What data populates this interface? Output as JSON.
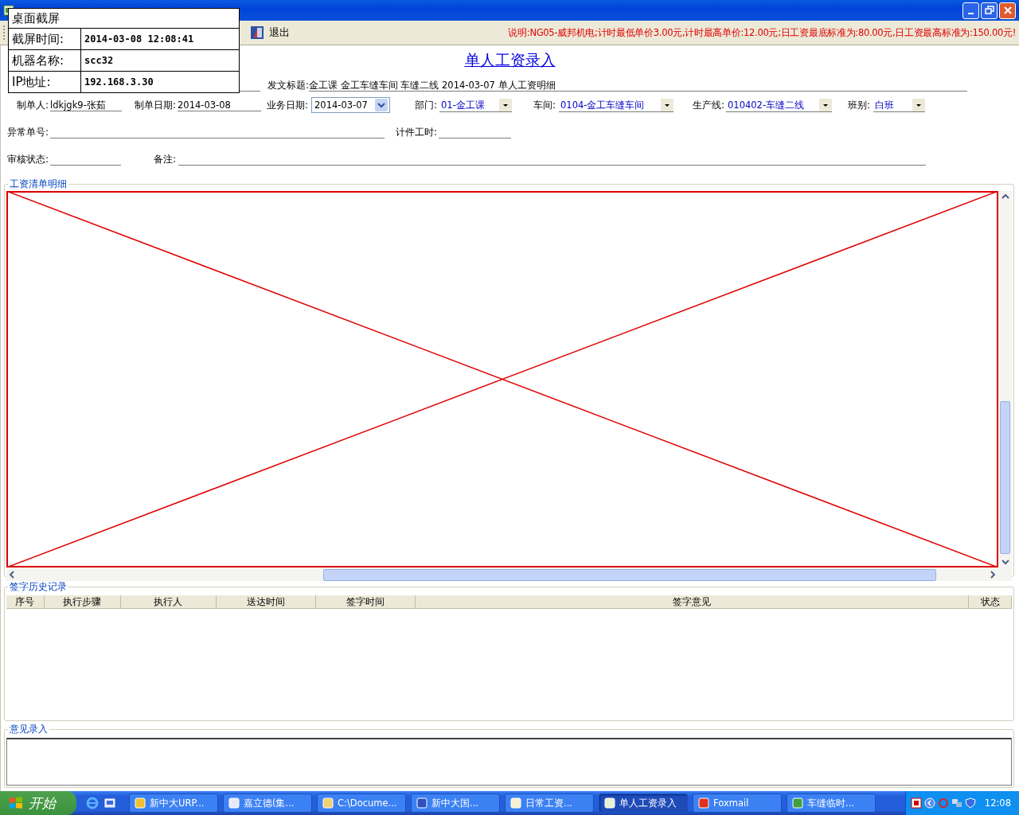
{
  "overlay": {
    "title": "桌面截屏",
    "rows": [
      {
        "label": "截屏时间:",
        "value": "2014-03-08 12:08:41"
      },
      {
        "label": "机器名称:",
        "value": "scc32"
      },
      {
        "label": "IP地址:",
        "value": "192.168.3.30"
      }
    ]
  },
  "toolbar": {
    "exit_button": "退出",
    "notice": "说明:NG05-威邦机电;计时最低单价3.00元,计时最高单价:12.00元;日工资最底标准为:80.00元,日工资最高标准为:150.00元!"
  },
  "form": {
    "heading": "单人工资录入",
    "subject_label": "发文标题:",
    "subject_value": "金工课 金工车缝车间 车缝二线 2014-03-07 单人工资明细",
    "rows": [
      [
        {
          "kind": "text",
          "label": "制单人:",
          "value": "ldkjgk9-张茹"
        },
        {
          "kind": "text",
          "label": "制单日期:",
          "value": "2014-03-08"
        },
        {
          "kind": "date",
          "label": "业务日期:",
          "value": "2014-03-07"
        },
        {
          "kind": "select",
          "label": "部门:",
          "value": "01-金工课"
        },
        {
          "kind": "select",
          "label": "车间:",
          "value": "0104-金工车缝车间"
        },
        {
          "kind": "select",
          "label": "生产线:",
          "value": "010402-车缝二线"
        },
        {
          "kind": "select",
          "label": "班别:",
          "value": "白班"
        }
      ],
      [
        {
          "kind": "text",
          "label": "异常单号:"
        },
        {
          "kind": "text",
          "label": "计件工时:"
        }
      ],
      [
        {
          "kind": "text",
          "label": "审核状态:"
        },
        {
          "kind": "text",
          "label": "备注:"
        }
      ]
    ]
  },
  "detail_panel": {
    "title": "工资清单明细"
  },
  "history": {
    "title": "签字历史记录",
    "columns": [
      "序号",
      "执行步骤",
      "执行人",
      "送达时间",
      "签字时间",
      "签字意见",
      "状态"
    ]
  },
  "comment": {
    "title": "意见录入"
  },
  "taskbar": {
    "start": "开始",
    "tasks": [
      {
        "label": "新中大URP...",
        "selected": false
      },
      {
        "label": "嘉立德(集...",
        "selected": false
      },
      {
        "label": "C:\\Docume...",
        "selected": false
      },
      {
        "label": "新中大国...",
        "selected": false
      },
      {
        "label": "日常工资...",
        "selected": false
      },
      {
        "label": "单人工资录入",
        "selected": true
      },
      {
        "label": "Foxmail",
        "selected": false
      },
      {
        "label": "车缝临时...",
        "selected": false
      }
    ],
    "clock": "12:08"
  }
}
